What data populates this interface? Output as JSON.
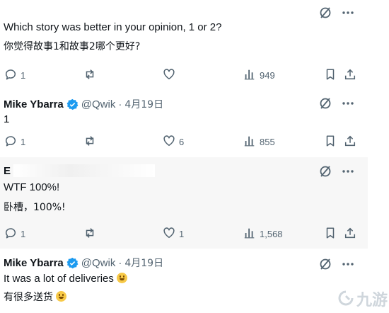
{
  "tweets": [
    {
      "lines": [
        "Which story was better in your opinion, 1 or 2?",
        "你觉得故事1和故事2哪个更好?"
      ],
      "reply_count": "1",
      "retweet_count": "",
      "like_count": "",
      "view_count": "949"
    },
    {
      "author": "Mike Ybarra",
      "handle": "@Qwik",
      "dot": "·",
      "date": "4月19日",
      "lines": [
        "1"
      ],
      "reply_count": "1",
      "retweet_count": "",
      "like_count": "6",
      "view_count": "855"
    },
    {
      "author_partial": "E",
      "lines": [
        "WTF 100%!",
        "卧槽，100%!"
      ],
      "reply_count": "1",
      "retweet_count": "",
      "like_count": "1",
      "view_count": "1,568"
    },
    {
      "author": "Mike Ybarra",
      "handle": "@Qwik",
      "dot": "·",
      "date": "4月19日",
      "lines": [
        "It was a lot of deliveries",
        "有很多送货"
      ]
    }
  ],
  "icons": {
    "grok": "grok-icon",
    "more": "more-icon",
    "reply": "reply-icon",
    "retweet": "retweet-icon",
    "like": "like-icon",
    "views": "views-icon",
    "bookmark": "bookmark-icon",
    "share": "share-icon",
    "verified": "verified-badge-icon",
    "emoji": "grinning-face-emoji"
  },
  "colors": {
    "verified": "#1d9bf0",
    "muted": "#536471",
    "text": "#0f1419"
  },
  "watermark": {
    "text": "九游"
  }
}
